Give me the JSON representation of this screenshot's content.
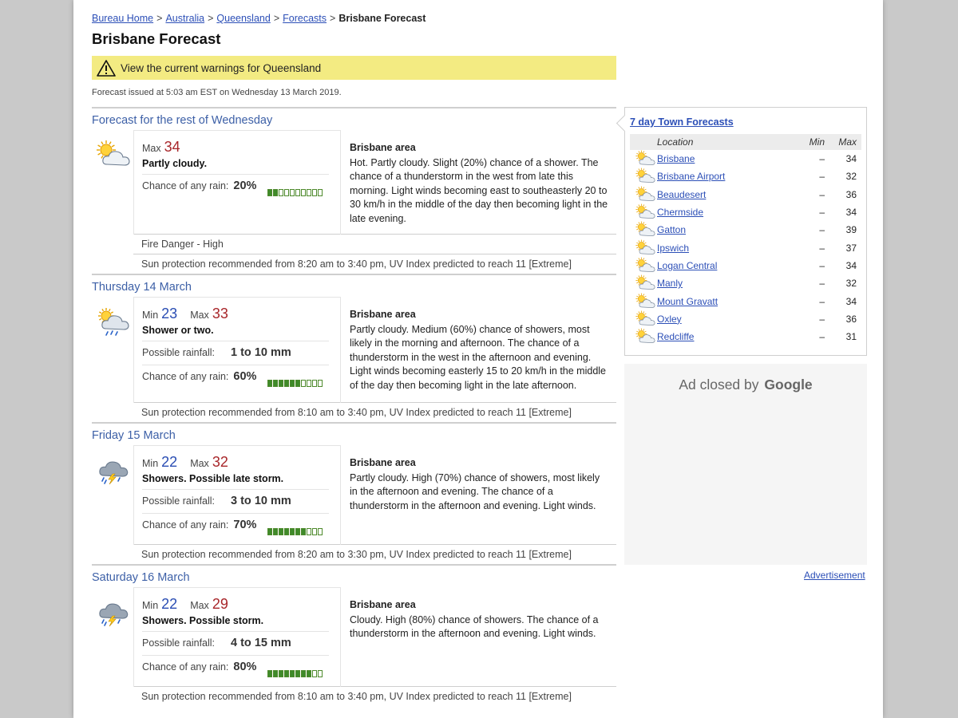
{
  "breadcrumb": [
    {
      "label": "Bureau Home",
      "link": true
    },
    {
      "label": "Australia",
      "link": true
    },
    {
      "label": "Queensland",
      "link": true
    },
    {
      "label": "Forecasts",
      "link": true
    },
    {
      "label": "Brisbane Forecast",
      "link": false
    }
  ],
  "breadcrumb_separator": ">",
  "page_title": "Brisbane Forecast",
  "warning_link": "View the current warnings for Queensland",
  "issued": "Forecast issued at 5:03 am EST on Wednesday 13 March 2019.",
  "labels": {
    "min": "Min",
    "max": "Max",
    "possible_rainfall": "Possible rainfall:",
    "chance_of_rain": "Chance of any rain:",
    "area_title": "Brisbane area"
  },
  "days": [
    {
      "heading": "Forecast for the rest of Wednesday",
      "icon": "partly-cloudy-icon",
      "min": null,
      "max": "34",
      "precis": "Partly cloudy.",
      "rainfall": null,
      "rain_chance": "20%",
      "rain_chance_fraction": 0.2,
      "area_text": "Hot. Partly cloudy. Slight (20%) chance of a shower. The chance of a thunderstorm in the west from late this morning. Light winds becoming east to southeasterly 20 to 30 km/h in the middle of the day then becoming light in the late evening.",
      "fire_danger": "Fire Danger - High",
      "sun": "Sun protection recommended from 8:20 am to 3:40 pm, UV Index predicted to reach 11 [Extreme]"
    },
    {
      "heading": "Thursday 14 March",
      "icon": "shower-icon",
      "min": "23",
      "max": "33",
      "precis": "Shower or two.",
      "rainfall": "1 to 10 mm",
      "rain_chance": "60%",
      "rain_chance_fraction": 0.6,
      "area_text": "Partly cloudy. Medium (60%) chance of showers, most likely in the morning and afternoon. The chance of a thunderstorm in the west in the afternoon and evening. Light winds becoming easterly 15 to 20 km/h in the middle of the day then becoming light in the late afternoon.",
      "fire_danger": null,
      "sun": "Sun protection recommended from 8:10 am to 3:40 pm, UV Index predicted to reach 11 [Extreme]"
    },
    {
      "heading": "Friday 15 March",
      "icon": "storm-icon",
      "min": "22",
      "max": "32",
      "precis": "Showers. Possible late storm.",
      "rainfall": "3 to 10 mm",
      "rain_chance": "70%",
      "rain_chance_fraction": 0.7,
      "area_text": "Partly cloudy. High (70%) chance of showers, most likely in the afternoon and evening. The chance of a thunderstorm in the afternoon and evening. Light winds.",
      "fire_danger": null,
      "sun": "Sun protection recommended from 8:20 am to 3:30 pm, UV Index predicted to reach 11 [Extreme]"
    },
    {
      "heading": "Saturday 16 March",
      "icon": "storm-icon",
      "min": "22",
      "max": "29",
      "precis": "Showers. Possible storm.",
      "rainfall": "4 to 15 mm",
      "rain_chance": "80%",
      "rain_chance_fraction": 0.8,
      "area_text": "Cloudy. High (80%) chance of showers. The chance of a thunderstorm in the afternoon and evening. Light winds.",
      "fire_danger": null,
      "sun": "Sun protection recommended from 8:10 am to 3:40 pm, UV Index predicted to reach 11 [Extreme]"
    }
  ],
  "town_forecasts": {
    "title": "7 day Town Forecasts",
    "headers": {
      "location": "Location",
      "min": "Min",
      "max": "Max"
    },
    "rows": [
      {
        "location": "Brisbane",
        "min": "–",
        "max": "34"
      },
      {
        "location": "Brisbane Airport",
        "min": "–",
        "max": "32"
      },
      {
        "location": "Beaudesert",
        "min": "–",
        "max": "36"
      },
      {
        "location": "Chermside",
        "min": "–",
        "max": "34"
      },
      {
        "location": "Gatton",
        "min": "–",
        "max": "39"
      },
      {
        "location": "Ipswich",
        "min": "–",
        "max": "37"
      },
      {
        "location": "Logan Central",
        "min": "–",
        "max": "34"
      },
      {
        "location": "Manly",
        "min": "–",
        "max": "32"
      },
      {
        "location": "Mount Gravatt",
        "min": "–",
        "max": "34"
      },
      {
        "location": "Oxley",
        "min": "–",
        "max": "36"
      },
      {
        "location": "Redcliffe",
        "min": "–",
        "max": "31"
      }
    ]
  },
  "ad": {
    "text": "Ad closed by",
    "brand": "Google",
    "link": "Advertisement"
  },
  "colors": {
    "min_temp": "#2a4db3",
    "max_temp": "#a8262a",
    "rain_bar": "#3f8a2a",
    "warning_bg": "#f3eb82",
    "heading": "#3d60a7"
  }
}
